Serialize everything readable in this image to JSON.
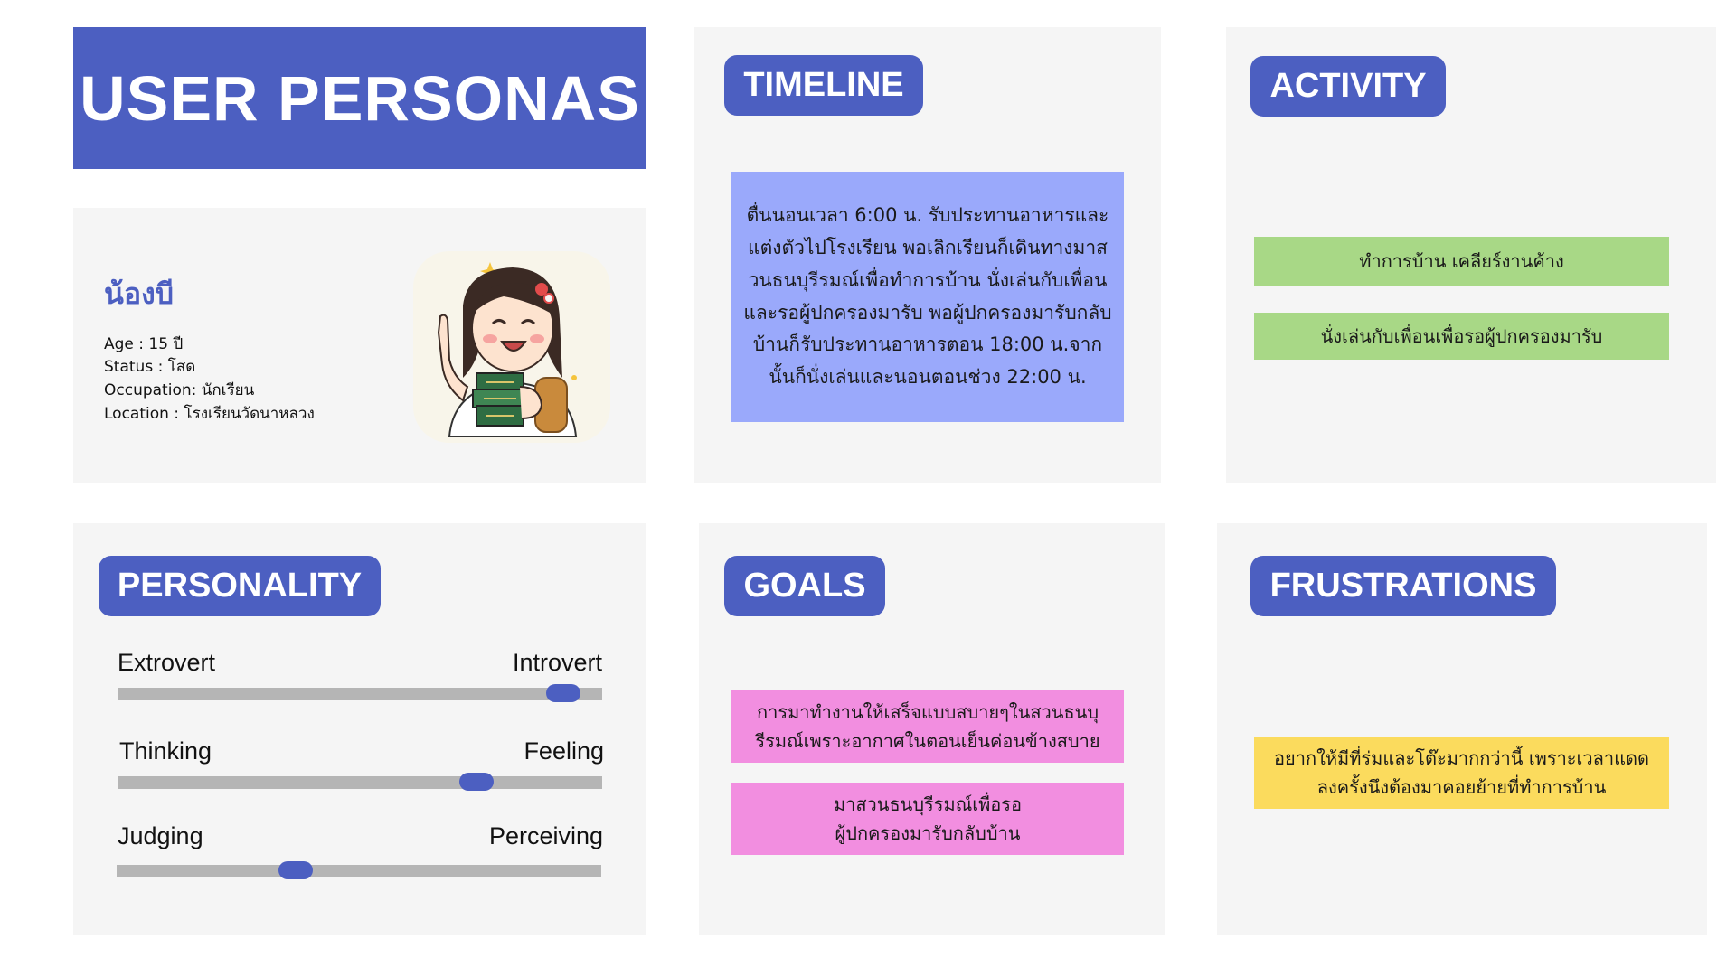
{
  "header": {
    "title": "USER PERSONAS"
  },
  "persona": {
    "name": "น้องบี",
    "age": "Age : 15 ปี",
    "status": "Status : โสด",
    "occupation": "Occupation: นักเรียน",
    "location": "Location : โรงเรียนวัดนาหลวง"
  },
  "timeline": {
    "label": "TIMELINE",
    "text": "ตื่นนอนเวลา 6:00 น. รับประทานอาหารและแต่งตัวไปโรงเรียน พอเลิกเรียนก็เดินทางมาสวนธนบุรีรมณ์เพื่อทำการบ้าน นั่งเล่นกับเพื่อน และรอผู้ปกครองมารับ พอผู้ปกครองมารับกลับบ้านก็รับประทานอาหารตอน 18:00 น.จากนั้นก็นั่งเล่นและนอนตอนช่วง 22:00 น."
  },
  "activity": {
    "label": "ACTIVITY",
    "items": [
      "ทำการบ้าน เคลียร์งานค้าง",
      "นั่งเล่นกับเพื่อนเพื่อรอผู้ปกครองมารับ"
    ]
  },
  "personality": {
    "label": "PERSONALITY",
    "sliders": [
      {
        "left": "Extrovert",
        "right": "Introvert",
        "value": 0.92
      },
      {
        "left": "Thinking",
        "right": "Feeling",
        "value": 0.74
      },
      {
        "left": "Judging",
        "right": "Perceiving",
        "value": 0.37
      }
    ]
  },
  "goals": {
    "label": "GOALS",
    "items": [
      "การมาทำงานให้เสร็จแบบสบายๆในสวนธนบุรีรมณ์เพราะอากาศในตอนเย็นค่อนข้างสบาย",
      "มาสวนธนบุรีรมณ์เพื่อรอผู้ปกครองมารับกลับบ้าน"
    ]
  },
  "frustrations": {
    "label": "FRUSTRATIONS",
    "items": [
      "อยากให้มีที่ร่มและโต๊ะมากกว่านี้ เพราะเวลาแดดลงครั้งนึงต้องมาคอยย้ายที่ทำการบ้าน"
    ]
  },
  "colors": {
    "accent": "#4c5fc1",
    "card": "#f5f5f5",
    "timeline_note": "#9aa9fb",
    "activity_note": "#a8d886",
    "goals_note": "#f28ee0",
    "frustration_note": "#fbdb5d"
  },
  "icons": {
    "avatar": "girl-student-with-books-avatar"
  }
}
